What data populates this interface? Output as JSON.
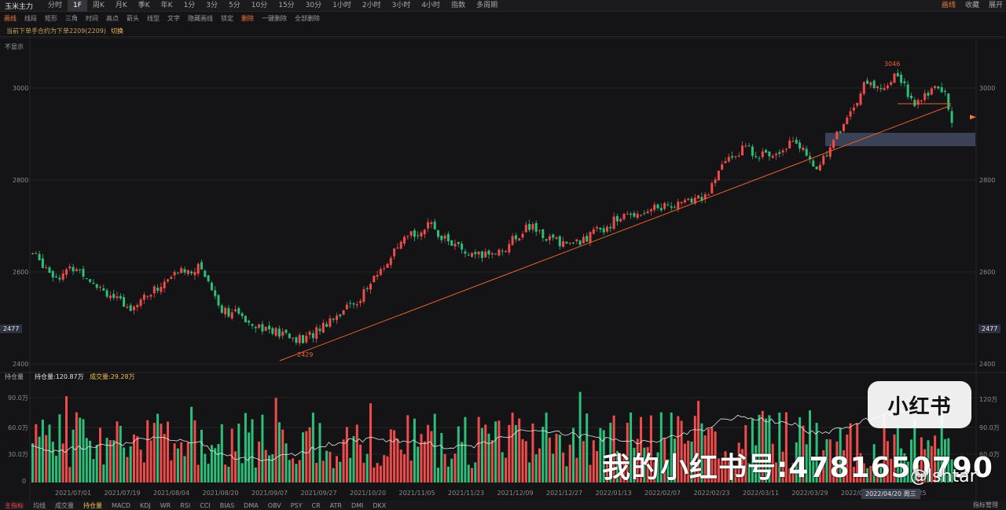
{
  "toolbar": {
    "symbol": "玉米主力",
    "timeframes": [
      "分时",
      "1F",
      "周K",
      "月K",
      "季K",
      "年K",
      "1分",
      "3分",
      "5分",
      "10分",
      "15分",
      "30分",
      "1小时",
      "2小时",
      "3小时",
      "4小时",
      "指数",
      "多周期"
    ],
    "active_timeframe": "1F",
    "right_buttons": [
      "画线",
      "收藏",
      "展开"
    ]
  },
  "draw_tools": [
    "画线",
    "线段",
    "矩形",
    "三角",
    "时间",
    "高点",
    "箭头",
    "线型",
    "文字",
    "隐藏画线",
    "锁定",
    "删除",
    "一键删除",
    "全部删除"
  ],
  "hint": {
    "text": "当前下单手合约为下单2209(2209)",
    "action": "切换"
  },
  "chart": {
    "unshow_label": "不显示",
    "price_axis_left": [
      "3000",
      "2800",
      "2600",
      "2400"
    ],
    "price_axis_right": [
      "3000",
      "2800",
      "2600",
      "2400"
    ],
    "current_price": "2477",
    "high_label": "3046",
    "low_label": "2429",
    "volume_axis_left": [
      "90.0万",
      "60.0万",
      "30.0万",
      "0"
    ],
    "volume_axis_right": [
      "120万",
      "90.0万",
      "60.0万"
    ],
    "indicator_select": "持仓量",
    "oi_value": "持仓量:120.87万",
    "volume_value": "成交量:29.28万",
    "dates": [
      "2021/07/01",
      "2021/07/19",
      "2021/08/04",
      "2021/08/20",
      "2021/09/07",
      "2021/09/27",
      "2021/10/20",
      "2021/11/05",
      "2021/11/23",
      "2021/12/09",
      "2021/12/27",
      "2022/01/13",
      "2022/02/07",
      "2022/02/23",
      "2022/03/11",
      "2022/03/29",
      "2022/04",
      "2022/05/25"
    ],
    "cursor_date": "2022/04/20 周三",
    "colors": {
      "up": "#ef4b4b",
      "down": "#2bbf7a",
      "trend": "#e8622c",
      "zone": "#3b4157"
    }
  },
  "chart_data": {
    "type": "candlestick",
    "x_start": "2021/07/01",
    "x_end": "2022/05/25",
    "ylim": [
      2400,
      3100
    ],
    "key_levels": {
      "high": 3046,
      "low": 2429,
      "last": 2477
    },
    "trendline": {
      "from": [
        2021.72,
        2429
      ],
      "to": [
        2022.4,
        2950
      ]
    },
    "volume": {
      "ylim_wan": [
        0,
        100
      ],
      "open_interest_wan": 120.87,
      "volume_wan": 29.28
    }
  },
  "indicators": [
    "主指标",
    "均线",
    "成交量",
    "持仓量",
    "MACD",
    "KDJ",
    "WR",
    "RSI",
    "CCI",
    "BIAS",
    "DMA",
    "OBV",
    "PSY",
    "CR",
    "ATR",
    "DMI",
    "DKX"
  ],
  "active_indicator": "持仓量",
  "indicator_right": "指标管理",
  "watermark": {
    "badge": "小红书",
    "id_text": "我的小红书号:4781650790",
    "handle": "@lshtar"
  }
}
